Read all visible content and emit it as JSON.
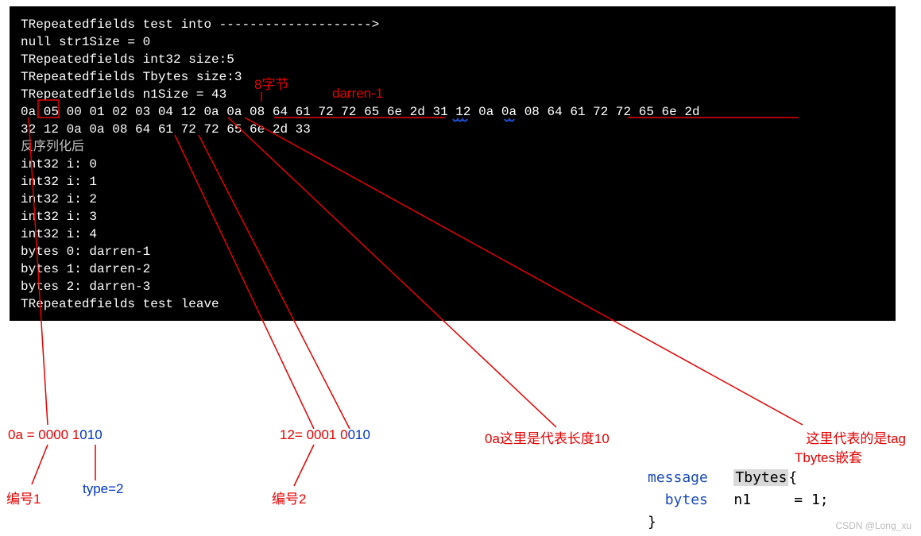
{
  "terminal": {
    "lines": [
      "TRepeatedfields test into -------------------->",
      "null str1Size = 0",
      "TRepeatedfields int32 size:5",
      "TRepeatedfields Tbytes size:3",
      "TRepeatedfields n1Size = 43",
      "0a 05 00 01 02 03 04 12 0a 0a 08 64 61 72 72 65 6e 2d 31 12 0a 0a 08 64 61 72 72 65 6e 2d",
      "32 12 0a 0a 08 64 61 72 72 65 6e 2d 33",
      "反序列化后",
      "int32 i: 0",
      "int32 i: 1",
      "int32 i: 2",
      "int32 i: 3",
      "int32 i: 4",
      "bytes 0: darren-1",
      "bytes 1: darren-2",
      "bytes 2: darren-3",
      "TRepeatedfields test leave"
    ]
  },
  "ann": {
    "bytes8": "8字节",
    "darren1": "darren-1",
    "eq0a_pre": "0a = ",
    "eq0a_a": "0000 1",
    "eq0a_b": "010",
    "eq12_pre": "12= ",
    "eq12_a": "0001 0",
    "eq12_b": "010",
    "len10": "0a这里是代表长度10",
    "tag_l1": "这里代表的是tag",
    "tag_l2": "Tbytes嵌套",
    "num1": "编号1",
    "type2": "type=2",
    "num2": "编号2"
  },
  "codebox": {
    "l1_kw": "message",
    "l1_typ": "Tbytes",
    "l1_tail": "{",
    "l2_kw": "bytes",
    "l2_name": "n1",
    "l2_tail": "= 1;",
    "l3": "}"
  },
  "watermark": "CSDN @Long_xu"
}
